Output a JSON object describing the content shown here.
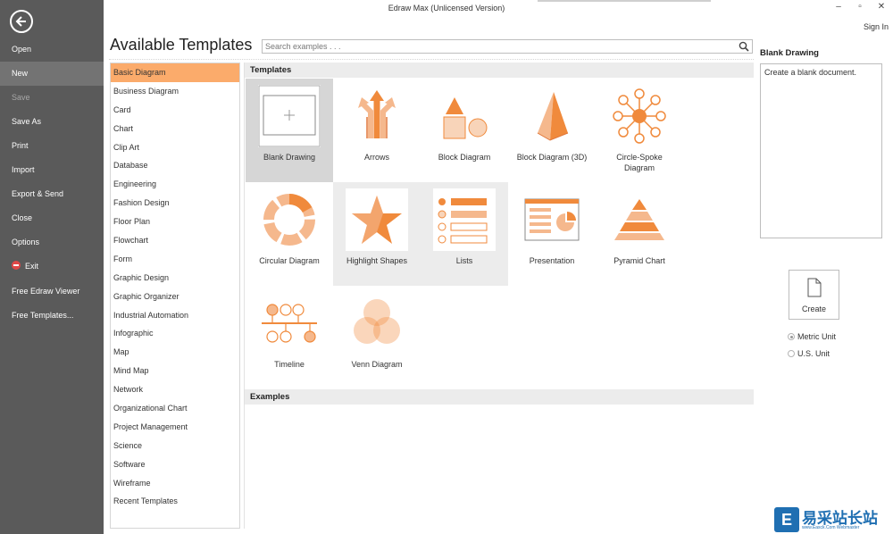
{
  "window": {
    "title": "Edraw Max (Unlicensed Version)",
    "sign_in": "Sign In",
    "minimize": "–",
    "restore": "▫",
    "close": "✕"
  },
  "sidebar": {
    "items": [
      {
        "label": "Open",
        "state": "normal"
      },
      {
        "label": "New",
        "state": "active"
      },
      {
        "label": "Save",
        "state": "disabled"
      },
      {
        "label": "Save As",
        "state": "normal"
      },
      {
        "label": "Print",
        "state": "normal"
      },
      {
        "label": "Import",
        "state": "normal"
      },
      {
        "label": "Export & Send",
        "state": "normal"
      },
      {
        "label": "Close",
        "state": "normal"
      },
      {
        "label": "Options",
        "state": "normal"
      },
      {
        "label": "Exit",
        "state": "normal",
        "icon": "exit-icon"
      },
      {
        "label": "Free Edraw Viewer",
        "state": "normal"
      },
      {
        "label": "Free Templates...",
        "state": "normal"
      }
    ]
  },
  "main": {
    "heading": "Available Templates",
    "search_placeholder": "Search examples . . .",
    "categories": [
      "Basic Diagram",
      "Business Diagram",
      "Card",
      "Chart",
      "Clip Art",
      "Database",
      "Engineering",
      "Fashion Design",
      "Floor Plan",
      "Flowchart",
      "Form",
      "Graphic Design",
      "Graphic Organizer",
      "Industrial Automation",
      "Infographic",
      "Map",
      "Mind Map",
      "Network",
      "Organizational Chart",
      "Project Management",
      "Science",
      "Software",
      "Wireframe",
      "Recent Templates"
    ],
    "selected_category": "Basic Diagram",
    "templates_header": "Templates",
    "examples_header": "Examples",
    "templates": [
      {
        "label": "Blank Drawing",
        "icon": "blank-drawing-icon",
        "state": "selected"
      },
      {
        "label": "Arrows",
        "icon": "arrows-icon",
        "state": "normal"
      },
      {
        "label": "Block Diagram",
        "icon": "block-diagram-icon",
        "state": "normal"
      },
      {
        "label": "Block Diagram (3D)",
        "icon": "block-diagram-3d-icon",
        "state": "normal"
      },
      {
        "label": "Circle-Spoke Diagram",
        "icon": "circle-spoke-icon",
        "state": "normal"
      },
      {
        "label": "Circular Diagram",
        "icon": "circular-diagram-icon",
        "state": "normal"
      },
      {
        "label": "Highlight Shapes",
        "icon": "highlight-shapes-icon",
        "state": "hover"
      },
      {
        "label": "Lists",
        "icon": "lists-icon",
        "state": "hover"
      },
      {
        "label": "Presentation",
        "icon": "presentation-icon",
        "state": "normal"
      },
      {
        "label": "Pyramid Chart",
        "icon": "pyramid-chart-icon",
        "state": "normal"
      },
      {
        "label": "Timeline",
        "icon": "timeline-icon",
        "state": "normal"
      },
      {
        "label": "Venn Diagram",
        "icon": "venn-diagram-icon",
        "state": "normal"
      }
    ]
  },
  "preview": {
    "title": "Blank Drawing",
    "description": "Create a blank document.",
    "create_label": "Create",
    "units": [
      {
        "label": "Metric Unit",
        "checked": true
      },
      {
        "label": "U.S. Unit",
        "checked": false
      }
    ]
  },
  "watermark": {
    "logo": "E",
    "text": "易采站长站",
    "sub": "www.Easck.Com Webmaster"
  },
  "colors": {
    "sidebar_bg": "#5a5a5a",
    "accent_orange": "#f08a3c",
    "selected_category": "#fbab6b",
    "shape_fill": "#f8d4b9"
  }
}
